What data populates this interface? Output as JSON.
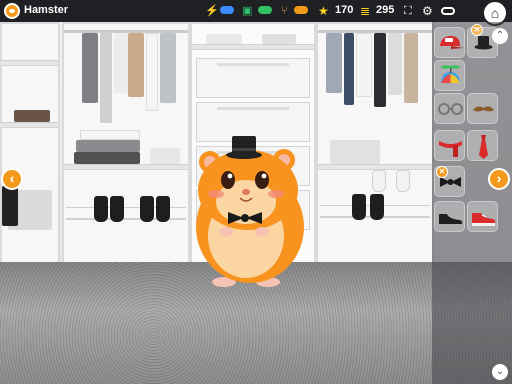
{
  "app": {
    "title": "Hamster"
  },
  "resources": {
    "stars": "170",
    "coins": "295"
  },
  "icons": {
    "energy": "lightning-bolt-icon",
    "camera": "camera-icon",
    "food": "fork-knife-icon",
    "star": "star-icon",
    "coins": "coin-stack-icon",
    "fullscreen": "expand-icon",
    "settings": "gear-icon",
    "gamepad": "gamepad-icon",
    "home": "home-icon"
  },
  "colors": {
    "accent": "#f39a1c",
    "topbar": "#1f2023",
    "energy": "#3d8bff",
    "health": "#33c064"
  },
  "wardrobe": {
    "items": [
      {
        "name": "red-cap",
        "equipped": true
      },
      {
        "name": "black-top-hat",
        "equipped": true
      },
      {
        "name": "propeller-beanie",
        "equipped": false
      },
      {
        "name": "round-glasses",
        "equipped": false
      },
      {
        "name": "mustache",
        "equipped": false
      },
      {
        "name": "red-scarf",
        "equipped": false
      },
      {
        "name": "red-necktie",
        "equipped": false
      },
      {
        "name": "black-bow-tie",
        "equipped": true
      },
      {
        "name": "black-dress-shoes",
        "equipped": false
      },
      {
        "name": "red-sneakers",
        "equipped": false
      }
    ]
  },
  "character": {
    "name": "hamster",
    "outfit": [
      "black-top-hat",
      "black-bow-tie"
    ]
  }
}
